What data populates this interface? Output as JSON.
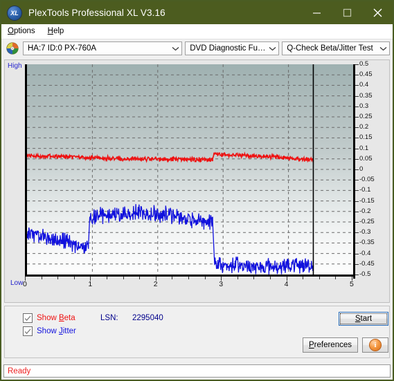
{
  "window": {
    "title": "PlexTools Professional XL V3.16",
    "app_icon": "xl-disc-icon",
    "icon_text": "XL",
    "minimize_label": "Minimize",
    "maximize_label": "Maximize",
    "close_label": "Close",
    "titlebar_color": "#4c5c1f",
    "border_color": "#4a5d23"
  },
  "menu": {
    "items": [
      {
        "pre": "",
        "accel": "O",
        "post": "ptions"
      },
      {
        "pre": "",
        "accel": "H",
        "post": "elp"
      }
    ]
  },
  "toolbar": {
    "disc_icon": "optical-disc-icon",
    "drive_select": "HA:7 ID:0  PX-760A",
    "function_select": "DVD Diagnostic Functions",
    "test_select": "Q-Check Beta/Jitter Test"
  },
  "chart_data": {
    "type": "line",
    "title": "Q-Check Beta/Jitter Test",
    "xlabel": "",
    "ylabel": "",
    "xlim": [
      0,
      5
    ],
    "ylim": [
      -0.5,
      0.5
    ],
    "xticks": [
      0,
      1,
      2,
      3,
      4,
      5
    ],
    "yticks": [
      0.5,
      0.45,
      0.4,
      0.35,
      0.3,
      0.25,
      0.2,
      0.15,
      0.1,
      0.05,
      0,
      -0.05,
      -0.1,
      -0.15,
      -0.2,
      -0.25,
      -0.3,
      -0.35,
      -0.4,
      -0.45,
      -0.5
    ],
    "ytick_labels": [
      "0.5",
      "0.45",
      "0.4",
      "0.35",
      "0.3",
      "0.25",
      "0.2",
      "0.15",
      "0.1",
      "0.05",
      "0",
      "-0.05",
      "-0.1",
      "-0.15",
      "-0.2",
      "-0.25",
      "-0.3",
      "-0.35",
      "-0.4",
      "-0.45",
      "-0.5"
    ],
    "xtick_labels": [
      "0",
      "1",
      "2",
      "3",
      "4",
      "5"
    ],
    "axis_high_label": "High",
    "axis_low_label": "Low",
    "grid": true,
    "grid_style": "dashed",
    "grid_color": "#6b6b6b",
    "plot_bg_top": "#9fb1b1",
    "plot_bg_bottom": "#fdfdfd",
    "data_end_marker_x": 4.38,
    "data_end_marker_color": "#000000",
    "series": [
      {
        "name": "Beta",
        "color": "#ee1111",
        "noise": 0.008,
        "segments": [
          {
            "x0": 0.0,
            "x1": 0.3,
            "y0": 0.068,
            "y1": 0.062
          },
          {
            "x0": 0.3,
            "x1": 1.6,
            "y0": 0.062,
            "y1": 0.05
          },
          {
            "x0": 1.6,
            "x1": 2.84,
            "y0": 0.05,
            "y1": 0.046
          },
          {
            "x0": 2.84,
            "x1": 2.86,
            "y0": 0.046,
            "y1": 0.072
          },
          {
            "x0": 2.86,
            "x1": 3.8,
            "y0": 0.072,
            "y1": 0.06
          },
          {
            "x0": 3.8,
            "x1": 4.38,
            "y0": 0.06,
            "y1": 0.046
          }
        ]
      },
      {
        "name": "Jitter",
        "color": "#1111dd",
        "noise": 0.03,
        "segments": [
          {
            "x0": 0.0,
            "x1": 0.18,
            "y0": -0.305,
            "y1": -0.315
          },
          {
            "x0": 0.18,
            "x1": 0.6,
            "y0": -0.315,
            "y1": -0.345
          },
          {
            "x0": 0.6,
            "x1": 0.88,
            "y0": -0.345,
            "y1": -0.372
          },
          {
            "x0": 0.88,
            "x1": 0.94,
            "y0": -0.372,
            "y1": -0.36
          },
          {
            "x0": 0.94,
            "x1": 0.96,
            "y0": -0.36,
            "y1": -0.225
          },
          {
            "x0": 0.96,
            "x1": 1.7,
            "y0": -0.225,
            "y1": -0.205
          },
          {
            "x0": 1.7,
            "x1": 2.1,
            "y0": -0.205,
            "y1": -0.212
          },
          {
            "x0": 2.1,
            "x1": 2.55,
            "y0": -0.212,
            "y1": -0.24
          },
          {
            "x0": 2.55,
            "x1": 2.84,
            "y0": -0.24,
            "y1": -0.248
          },
          {
            "x0": 2.84,
            "x1": 2.87,
            "y0": -0.248,
            "y1": -0.455
          },
          {
            "x0": 2.87,
            "x1": 3.7,
            "y0": -0.455,
            "y1": -0.462
          },
          {
            "x0": 3.7,
            "x1": 4.38,
            "y0": -0.462,
            "y1": -0.455
          }
        ]
      }
    ]
  },
  "options": {
    "show_beta": {
      "pre": "Show ",
      "accel": "B",
      "post": "eta",
      "checked": true,
      "color": "#ee1111"
    },
    "show_jitter": {
      "pre": "Show ",
      "accel": "J",
      "post": "itter",
      "checked": true,
      "color": "#1111dd"
    },
    "lsn_label": "LSN:",
    "lsn_value": "2295040",
    "start_button": {
      "pre": "",
      "accel": "S",
      "post": "tart"
    },
    "preferences_button": {
      "pre": "",
      "accel": "P",
      "post": "references"
    },
    "info_button": "info-icon",
    "info_glyph": "i"
  },
  "status": {
    "text": "Ready",
    "color": "#ee2222"
  }
}
